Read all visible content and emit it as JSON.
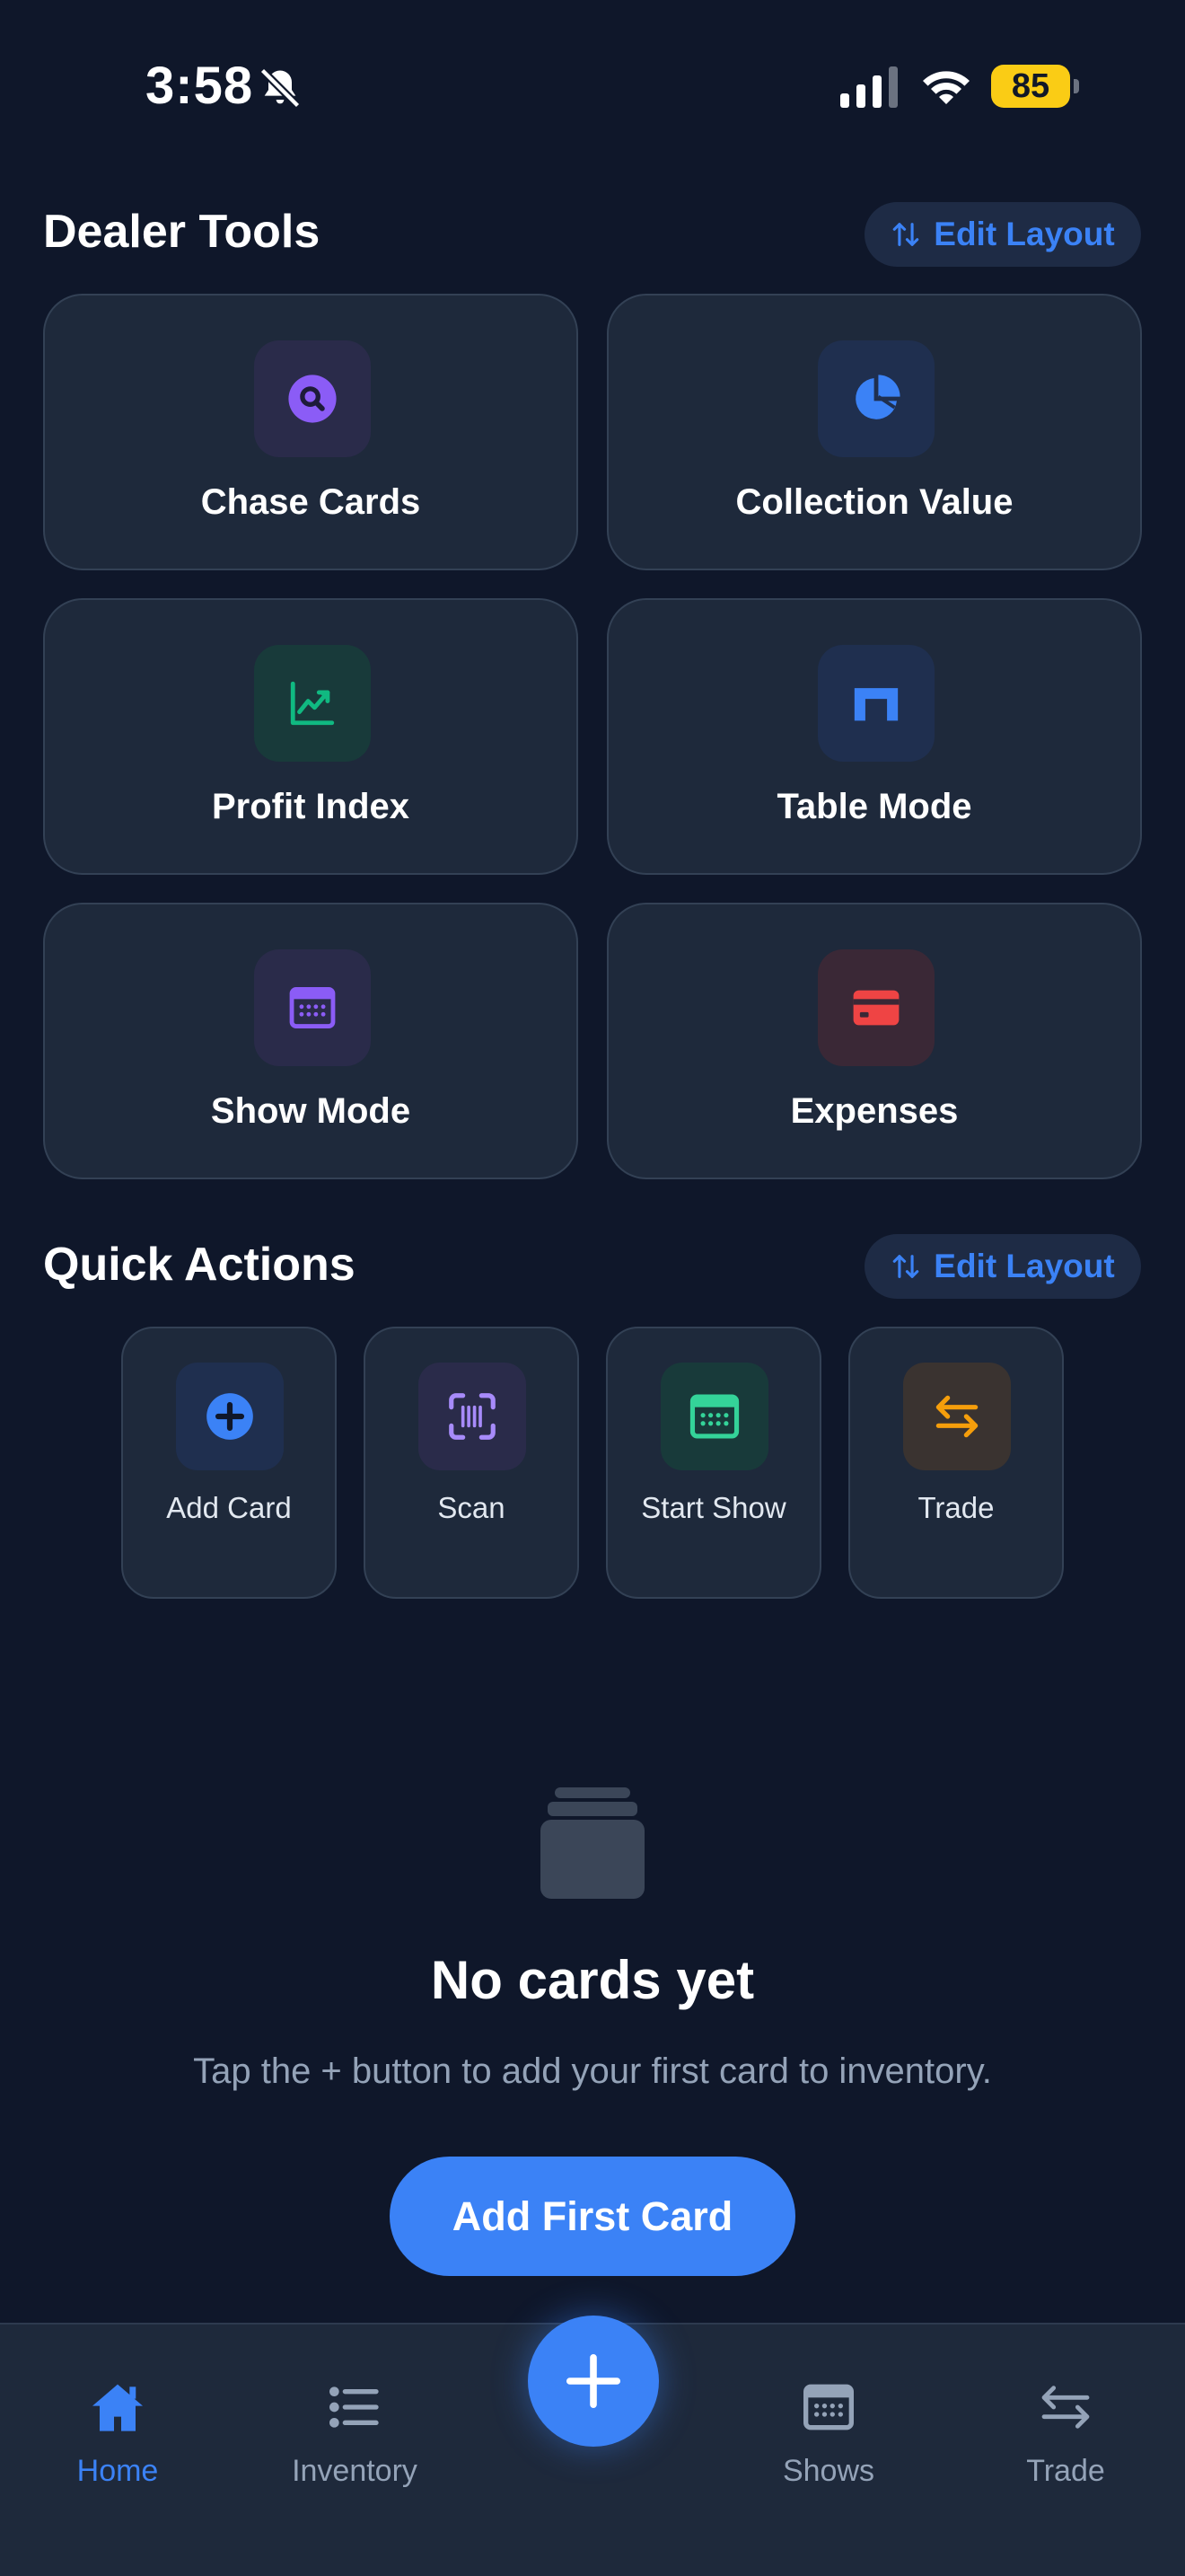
{
  "status_bar": {
    "time": "3:58",
    "battery": "85"
  },
  "dealer_tools": {
    "title": "Dealer Tools",
    "edit_label": "Edit Layout",
    "tools": [
      {
        "label": "Chase Cards",
        "icon": "magnifier-icon",
        "color": "#8b5cf6"
      },
      {
        "label": "Collection Value",
        "icon": "pie-chart-icon",
        "color": "#3b82f6"
      },
      {
        "label": "Profit Index",
        "icon": "trend-up-icon",
        "color": "#10b981"
      },
      {
        "label": "Table Mode",
        "icon": "table-icon",
        "color": "#3b82f6"
      },
      {
        "label": "Show Mode",
        "icon": "calendar-icon",
        "color": "#8b5cf6"
      },
      {
        "label": "Expenses",
        "icon": "credit-card-icon",
        "color": "#ef4444"
      }
    ]
  },
  "quick_actions": {
    "title": "Quick Actions",
    "edit_label": "Edit Layout",
    "actions": [
      {
        "label": "Add Card",
        "icon": "plus-circle-icon",
        "color": "#3b82f6"
      },
      {
        "label": "Scan",
        "icon": "barcode-scan-icon",
        "color": "#a78bfa"
      },
      {
        "label": "Start Show",
        "icon": "calendar-icon",
        "color": "#34d399"
      },
      {
        "label": "Trade",
        "icon": "swap-arrows-icon",
        "color": "#f59e0b"
      }
    ]
  },
  "empty_state": {
    "title": "No cards yet",
    "description": "Tap the + button to add your first card to inventory.",
    "button_label": "Add First Card"
  },
  "tab_bar": {
    "tabs": [
      {
        "label": "Home",
        "icon": "home-icon",
        "active": true
      },
      {
        "label": "Inventory",
        "icon": "list-icon",
        "active": false
      },
      {
        "label": "Shows",
        "icon": "calendar-icon",
        "active": false
      },
      {
        "label": "Trade",
        "icon": "swap-arrows-icon",
        "active": false
      }
    ],
    "fab_icon": "plus-icon"
  },
  "colors": {
    "accent": "#3b82f6",
    "background": "#0f172a",
    "card": "#1e293b"
  }
}
